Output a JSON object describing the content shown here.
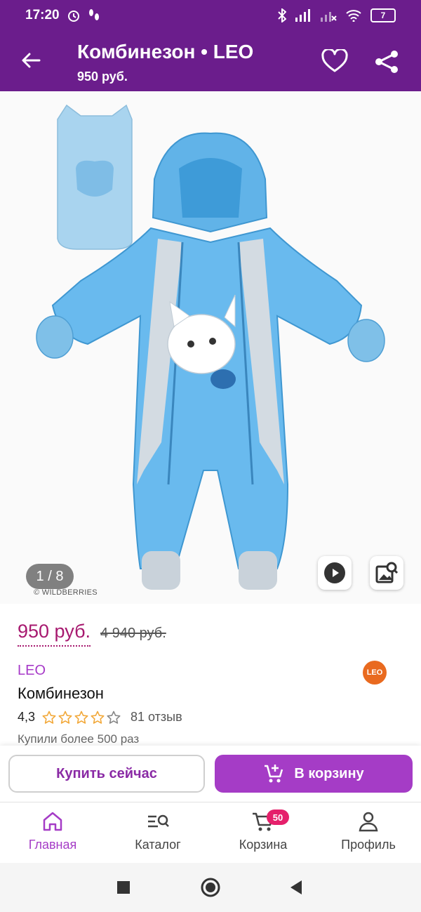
{
  "status_bar": {
    "time": "17:20",
    "battery": "7"
  },
  "app_bar": {
    "title": "Комбинезон • LEO",
    "subtitle": "950 руб."
  },
  "gallery": {
    "counter": "1 / 8",
    "watermark": "© WILDBERRIES"
  },
  "product": {
    "price": "950 руб.",
    "old_price": "4 940 руб.",
    "brand": "LEO",
    "brand_logo_text": "LEO",
    "name": "Комбинезон",
    "rating": "4,3",
    "rating_stars": 4.3,
    "reviews": "81 отзыв",
    "bought": "Купили более 500 раз"
  },
  "actions": {
    "buy_now": "Купить сейчас",
    "add_to_cart": "В корзину"
  },
  "tabs": [
    {
      "label": "Главная",
      "icon": "home-icon",
      "active": true
    },
    {
      "label": "Каталог",
      "icon": "catalog-search-icon",
      "active": false
    },
    {
      "label": "Корзина",
      "icon": "cart-icon",
      "active": false,
      "badge": "50"
    },
    {
      "label": "Профиль",
      "icon": "profile-icon",
      "active": false
    }
  ],
  "colors": {
    "brand_purple": "#6b1d8c",
    "accent": "#a53cc6",
    "price": "#a7196f",
    "badge": "#e5206b"
  }
}
